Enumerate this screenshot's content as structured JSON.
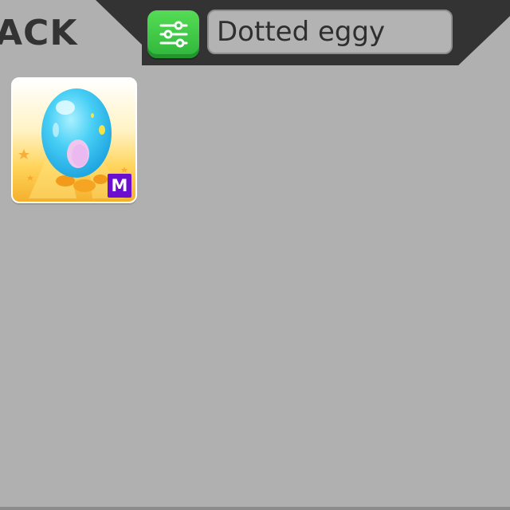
{
  "header": {
    "back_label": "ACK",
    "bar_color": "#333333"
  },
  "filter_button": {
    "icon": "sliders-icon",
    "color": "#3cc44a"
  },
  "search": {
    "value": "Dotted eggy"
  },
  "inventory": {
    "items": [
      {
        "icon": "blue-egg-icon",
        "rarity_badge": "M",
        "rarity_color": "#6a0fd0"
      }
    ]
  }
}
